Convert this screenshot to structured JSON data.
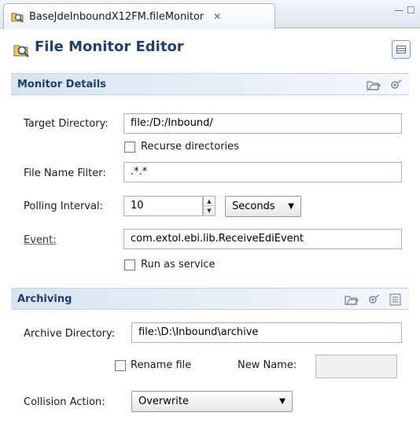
{
  "tab": {
    "title": "BaseJdeInboundX12FM.fileMonitor",
    "close_glyph": "✕"
  },
  "window_controls": {
    "minimize": "—",
    "maximize": "☐"
  },
  "header": {
    "title": "File Monitor Editor"
  },
  "monitor_details": {
    "title": "Monitor Details",
    "target_directory_label": "Target Directory:",
    "target_directory_value": "file:/D:/Inbound/",
    "recurse_label": "Recurse directories",
    "recurse_checked": false,
    "file_name_filter_label": "File Name Filter:",
    "file_name_filter_value": ".*.*",
    "polling_interval_label": "Polling Interval:",
    "polling_interval_value": "10",
    "polling_unit": "Seconds",
    "event_label": "Event:",
    "event_value": "com.extol.ebi.lib.ReceiveEdiEvent",
    "run_as_service_label": "Run as service",
    "run_as_service_checked": false
  },
  "archiving": {
    "title": "Archiving",
    "archive_directory_label": "Archive Directory:",
    "archive_directory_value": "file:\\D:\\Inbound\\archive",
    "rename_file_label": "Rename file",
    "rename_checked": false,
    "new_name_label": "New Name:",
    "new_name_value": "",
    "collision_action_label": "Collision Action:",
    "collision_action_value": "Overwrite"
  },
  "icons": {
    "tab": "file-monitor-icon",
    "header": "file-monitor-icon",
    "open_folder": "open-folder-icon",
    "browse": "browse-icon",
    "properties": "properties-icon"
  },
  "colors": {
    "title_blue": "#1f3f6e",
    "section_bg": "#d9e4f2"
  }
}
